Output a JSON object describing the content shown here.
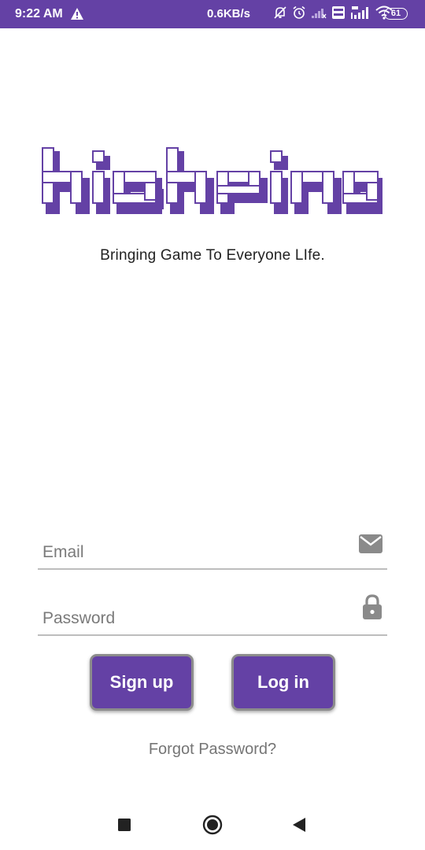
{
  "status_bar": {
    "time": "9:22 AM",
    "network_speed": "0.6KB/s",
    "battery": "61",
    "icons": [
      "warning-icon",
      "notifications-off-icon",
      "alarm-icon",
      "signal-weak-icon",
      "volte-icon",
      "signal-4g-icon",
      "wifi-icon",
      "battery-icon"
    ]
  },
  "brand": {
    "logo_text": "highping",
    "tagline": "Bringing Game To Everyone LIfe."
  },
  "form": {
    "email_placeholder": "Email",
    "password_placeholder": "Password",
    "email_icon": "envelope-icon",
    "password_icon": "lock-icon"
  },
  "actions": {
    "signup_label": "Sign up",
    "login_label": "Log in",
    "forgot_label": "Forgot Password?"
  },
  "colors": {
    "brand_purple": "#6441a5",
    "status_bar": "#6441a5",
    "text_secondary": "#757575"
  },
  "nav_bar": {
    "icons": [
      "recents-square-icon",
      "home-circle-icon",
      "back-triangle-icon"
    ]
  }
}
